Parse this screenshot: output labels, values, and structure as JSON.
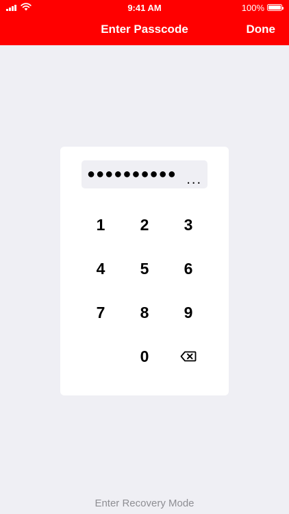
{
  "status_bar": {
    "time": "9:41 AM",
    "battery_percent": "100%",
    "battery_level": 1.0,
    "icons": [
      "cellular-signal-icon",
      "wifi-icon",
      "battery-icon"
    ]
  },
  "nav": {
    "title": "Enter Passcode",
    "done_label": "Done"
  },
  "passcode": {
    "masked_value": "●●●●●●●●●●",
    "overflow": "..."
  },
  "keypad": {
    "keys": [
      "1",
      "2",
      "3",
      "4",
      "5",
      "6",
      "7",
      "8",
      "9",
      "0"
    ],
    "delete_icon": "backspace-icon"
  },
  "footer": {
    "recovery_label": "Enter Recovery Mode"
  },
  "colors": {
    "header_background": "#FF0000",
    "page_background": "#EFEFF4",
    "card_background": "#FFFFFF",
    "secondary_text": "#8E8E93"
  }
}
